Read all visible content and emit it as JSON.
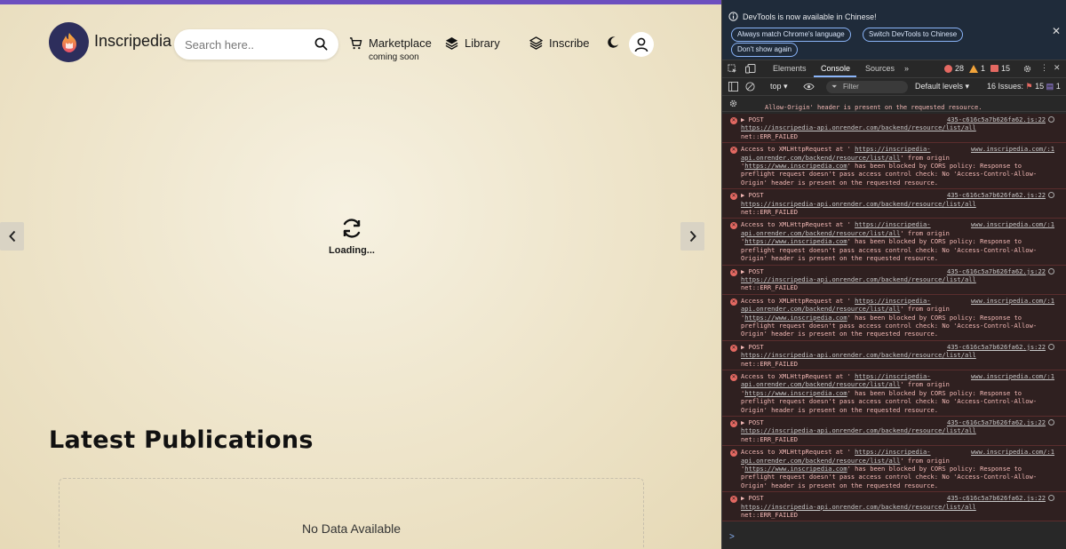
{
  "site": {
    "brand": "Inscripedia",
    "search_placeholder": "Search here..",
    "nav": {
      "marketplace": "Marketplace",
      "marketplace_sub": "coming soon",
      "library": "Library",
      "inscribe": "Inscribe"
    },
    "loading_text": "Loading...",
    "latest_heading": "Latest Publications",
    "no_data": "No Data Available",
    "accent": "#6c4fbf"
  },
  "devtools": {
    "info_title": "DevTools is now available in Chinese!",
    "buttons": {
      "match_language": "Always match Chrome's language",
      "switch_chinese": "Switch DevTools to Chinese",
      "dont_show": "Don't show again"
    },
    "tabs": {
      "elements": "Elements",
      "console": "Console",
      "sources": "Sources"
    },
    "counts": {
      "errors": "28",
      "warnings": "1",
      "issues_badge": "15"
    },
    "toolbar": {
      "context": "top",
      "filter_placeholder": "Filter",
      "levels": "Default levels",
      "issues_label": "16 Issues:",
      "issues_errors": "15",
      "issues_info": "1"
    },
    "partial_top": "Allow-Origin' header is present on the requested resource.",
    "post": {
      "method": "POST",
      "source": "435-c616c5a7b626fa62.js:22",
      "url": "https://inscripedia-api.onrender.com/backend/resource/list/all",
      "status": "net::ERR_FAILED"
    },
    "cors": {
      "prefix": "Access to XMLHttpRequest at '",
      "source": "www.inscripedia.com/:1",
      "url": "https://inscripedia-api.onrender.com/backend/resource/list/all",
      "mid1": "' from origin '",
      "origin": "https://www.inscripedia.com",
      "mid2": "' has been blocked by CORS policy: Response to preflight request doesn't pass access control check: No 'Access-Control-Allow-Origin' header is present on the requested resource."
    },
    "prompt": ">"
  }
}
